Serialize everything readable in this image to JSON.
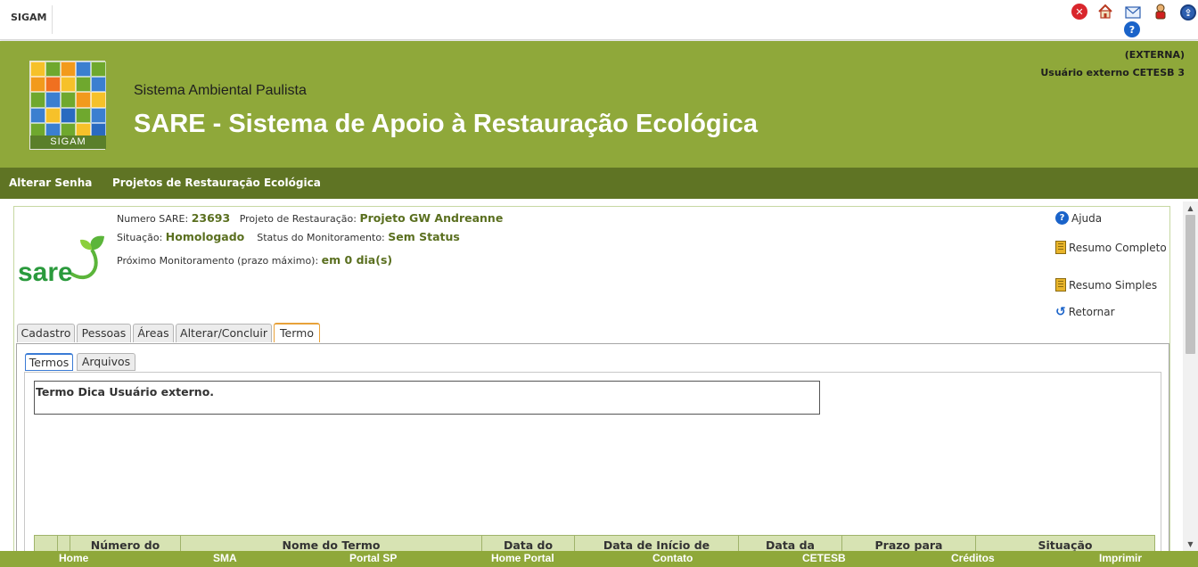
{
  "topbar": {
    "app": "SIGAM"
  },
  "header": {
    "logo_text": "SIGAM",
    "subtitle": "Sistema Ambiental Paulista",
    "title": "SARE - Sistema de Apoio à Restauração Ecológica",
    "external": "(EXTERNA)",
    "user": "Usuário externo CETESB 3"
  },
  "nav": {
    "items": [
      "Alterar Senha",
      "Projetos de Restauração Ecológica"
    ]
  },
  "project": {
    "logo_text": "sare",
    "numero_label": "Numero SARE:",
    "numero": "23693",
    "projeto_label": "Projeto de Restauração:",
    "projeto": "Projeto GW Andreanne",
    "situacao_label": "Situação:",
    "situacao": "Homologado",
    "status_label": "Status do Monitoramento:",
    "status": "Sem Status",
    "proximo_label": "Próximo Monitoramento (prazo máximo):",
    "proximo": "em 0 dia(s)"
  },
  "side_links": [
    "Ajuda",
    "Resumo Completo",
    "Resumo Simples",
    "Retornar"
  ],
  "tabs": [
    "Cadastro",
    "Pessoas",
    "Áreas",
    "Alterar/Concluir",
    "Termo"
  ],
  "active_tab": "Termo",
  "subtabs": [
    "Termos",
    "Arquivos"
  ],
  "active_subtab": "Termos",
  "note": "Termo Dica Usuário externo.",
  "table": {
    "headers": [
      "",
      "",
      "Número do",
      "Nome do Termo",
      "Data do",
      "Data de Início de",
      "Data da",
      "Prazo para",
      "Situação"
    ]
  },
  "footer": [
    "Home",
    "SMA",
    "Portal SP",
    "Home Portal",
    "Contato",
    "CETESB",
    "Créditos",
    "Imprimir"
  ],
  "colors": {
    "header_green": "#8fa83a",
    "nav_green": "#5f7424",
    "accent_orange": "#e8a23a"
  },
  "icons": [
    "close-icon",
    "home-icon",
    "mail-icon",
    "user-icon",
    "logout-icon",
    "help-icon"
  ]
}
